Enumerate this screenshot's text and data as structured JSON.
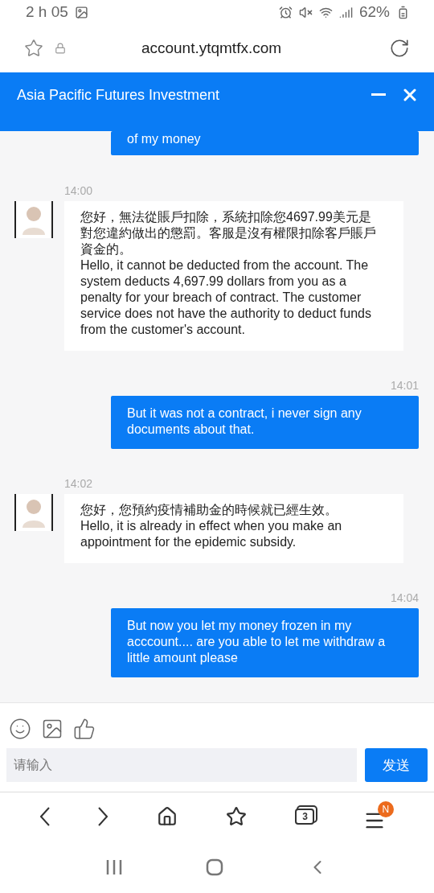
{
  "status_bar": {
    "time": "2 h 05",
    "battery": "62%"
  },
  "url_bar": {
    "url": "account.ytqmtfx.com"
  },
  "chat_header": {
    "title": "Asia Pacific Futures Investment"
  },
  "messages": [
    {
      "kind": "user",
      "text": "of my money"
    },
    {
      "kind": "agent",
      "time": "14:00",
      "lines": [
        "您好，無法從賬戶扣除，系統扣除您4697.99美元是對您違約做出的懲罰。客服是沒有權限扣除客戶賬戶資金的。",
        "Hello, it cannot be deducted from the account. The system deducts 4,697.99 dollars from you as a penalty for your breach of contract. The customer service does not have the authority to deduct funds from the customer's account."
      ]
    },
    {
      "kind": "user",
      "time": "14:01",
      "text": "But it was not a contract, i never sign any documents about that."
    },
    {
      "kind": "agent",
      "time": "14:02",
      "lines": [
        "您好，您預約疫情補助金的時候就已經生效。",
        "Hello, it is already in effect when you make an appointment for the epidemic subsidy."
      ]
    },
    {
      "kind": "user",
      "time": "14:04",
      "text": "But now you let my money frozen in my acccount.... are you able to let me withdraw a little amount please"
    }
  ],
  "composer": {
    "placeholder": "请输入",
    "send_button": "发送"
  },
  "browser_nav": {
    "tab_count": "3",
    "menu_badge": "N"
  }
}
